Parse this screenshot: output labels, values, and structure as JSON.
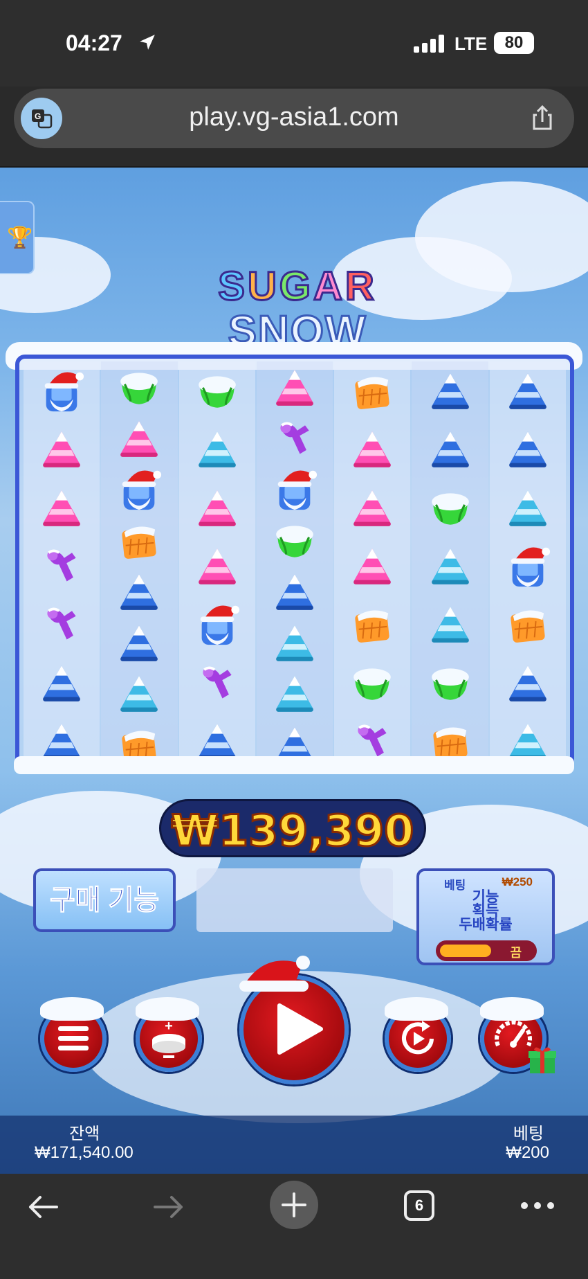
{
  "status": {
    "time": "04:27",
    "network": "LTE",
    "battery": "80"
  },
  "browser": {
    "url": "play.vg-asia1.com",
    "tab_count": "6"
  },
  "game": {
    "logo_top": [
      "S",
      "U",
      "G",
      "A",
      "R"
    ],
    "logo_bottom": "SNOW",
    "win_amount": "₩139,390",
    "buy_feature_label": "구매 기능",
    "ante": {
      "bet_label": "베팅",
      "price": "₩250",
      "line1": "기능",
      "line2": "획득",
      "line3": "두배확률",
      "toggle_state": "끔"
    },
    "balance_label": "잔액",
    "balance_value": "₩171,540.00",
    "bet_label": "베팅",
    "bet_value": "₩200",
    "grid": [
      [
        "santa",
        "pink",
        "pink",
        "purple",
        "purple",
        "blue",
        "blue"
      ],
      [
        "green",
        "pink",
        "santa",
        "orange",
        "blue",
        "blue",
        "teal",
        "orange"
      ],
      [
        "green",
        "teal",
        "pink",
        "pink",
        "santa",
        "purple",
        "blue"
      ],
      [
        "pink",
        "purple",
        "santa",
        "green",
        "blue",
        "teal",
        "teal",
        "blue"
      ],
      [
        "orange",
        "pink",
        "pink",
        "pink",
        "orange",
        "green",
        "purple"
      ],
      [
        "blue",
        "blue",
        "green",
        "teal",
        "teal",
        "green",
        "orange"
      ],
      [
        "blue",
        "blue",
        "teal",
        "santa",
        "orange",
        "blue",
        "teal"
      ]
    ]
  },
  "colors": {
    "accent_red": "#d01418",
    "board_border": "#3b57d6",
    "win_gold": "#ffd83a"
  }
}
